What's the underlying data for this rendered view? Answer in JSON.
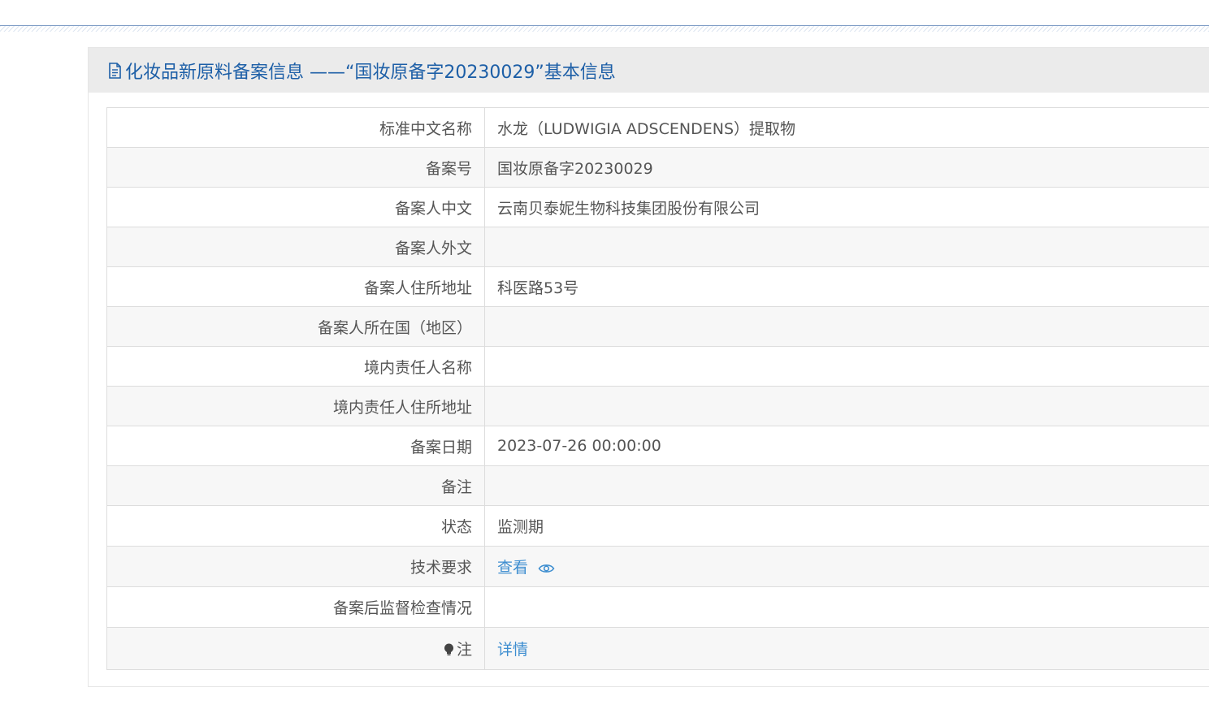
{
  "panel": {
    "title": "化妆品新原料备案信息 ——“国妆原备字20230029”基本信息",
    "icon": "document-icon"
  },
  "rows": [
    {
      "label": "标准中文名称",
      "value": "水龙（LUDWIGIA ADSCENDENS）提取物"
    },
    {
      "label": "备案号",
      "value": "国妆原备字20230029"
    },
    {
      "label": "备案人中文",
      "value": "云南贝泰妮生物科技集团股份有限公司"
    },
    {
      "label": "备案人外文",
      "value": ""
    },
    {
      "label": "备案人住所地址",
      "value": "科医路53号"
    },
    {
      "label": "备案人所在国（地区）",
      "value": ""
    },
    {
      "label": "境内责任人名称",
      "value": ""
    },
    {
      "label": "境内责任人住所地址",
      "value": ""
    },
    {
      "label": "备案日期",
      "value": "2023-07-26 00:00:00"
    },
    {
      "label": "备注",
      "value": ""
    },
    {
      "label": "状态",
      "value": "监测期"
    },
    {
      "label": "技术要求",
      "value": "查看",
      "icon": "eye-icon"
    },
    {
      "label": "备案后监督检查情况",
      "value": ""
    },
    {
      "label": "注",
      "value": "详情",
      "label_icon": "lightbulb-icon"
    }
  ],
  "colors": {
    "title": "#1d5fa7",
    "link": "#3e8ed0",
    "header_bg": "#ebebeb",
    "border": "#dddddd"
  }
}
